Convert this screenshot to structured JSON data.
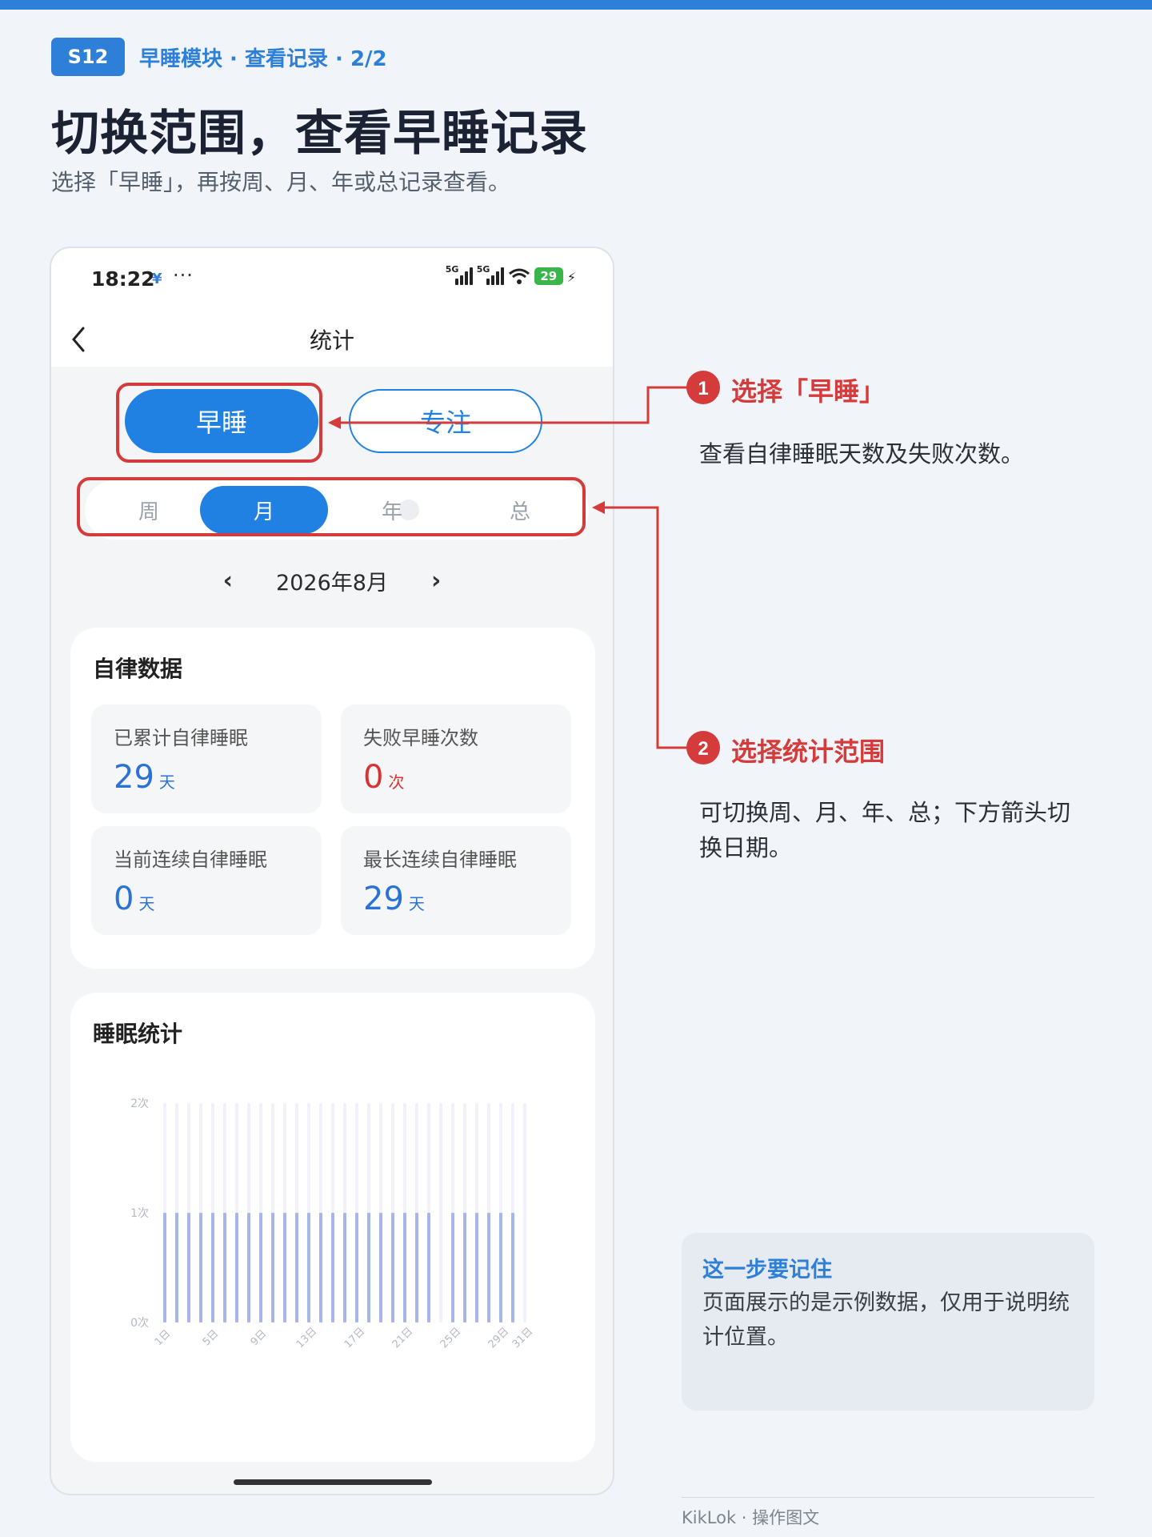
{
  "header": {
    "badge": "S12",
    "breadcrumb": "早睡模块 · 查看记录 · 2/2",
    "title": "切换范围，查看早睡记录",
    "subtitle": "选择「早睡」，再按周、月、年或总记录查看。"
  },
  "phone": {
    "status": {
      "time": "18:22",
      "battery": "29"
    },
    "nav_title": "统计",
    "tabs": [
      "早睡",
      "专注"
    ],
    "range_tabs": [
      "周",
      "月",
      "年",
      "总"
    ],
    "date": "2026年8月",
    "self_discipline": {
      "title": "自律数据",
      "stats": [
        {
          "label": "已累计自律睡眠",
          "value": "29",
          "unit": "天"
        },
        {
          "label": "失败早睡次数",
          "value": "0",
          "unit": "次"
        },
        {
          "label": "当前连续自律睡眠",
          "value": "0",
          "unit": "天"
        },
        {
          "label": "最长连续自律睡眠",
          "value": "29",
          "unit": "天"
        }
      ]
    },
    "sleep_stats_title": "睡眠统计"
  },
  "chart_data": {
    "type": "bar",
    "title": "睡眠统计",
    "y_tick_labels": [
      "0次",
      "1次",
      "2次"
    ],
    "x_tick_labels": [
      "1日",
      "5日",
      "9日",
      "13日",
      "17日",
      "21日",
      "25日",
      "29日",
      "31日"
    ],
    "ylim": [
      0,
      2
    ],
    "days": [
      1,
      2,
      3,
      4,
      5,
      6,
      7,
      8,
      9,
      10,
      11,
      12,
      13,
      14,
      15,
      16,
      17,
      18,
      19,
      20,
      21,
      22,
      23,
      24,
      25,
      26,
      27,
      28,
      29,
      30,
      31
    ],
    "values": [
      1,
      1,
      1,
      1,
      1,
      1,
      1,
      1,
      1,
      1,
      1,
      1,
      1,
      1,
      1,
      1,
      1,
      1,
      1,
      1,
      1,
      1,
      1,
      0,
      1,
      1,
      1,
      1,
      1,
      1,
      0
    ],
    "bar_color": "#a8b4ea",
    "track_color": "#f0f1fb",
    "grid": false
  },
  "callouts": [
    {
      "num": "1",
      "title": "选择「早睡」",
      "text": "查看自律睡眠天数及失败次数。"
    },
    {
      "num": "2",
      "title": "选择统计范围",
      "text": "可切换周、月、年、总；下方箭头切换日期。"
    }
  ],
  "note": {
    "title": "这一步要记住",
    "text": "页面展示的是示例数据，仅用于说明统计位置。"
  },
  "footer": "KikLok · 操作图文",
  "colors": {
    "accent": "#2e7fd8",
    "highlight": "#d53b3b",
    "tab_blue": "#2081e2"
  }
}
